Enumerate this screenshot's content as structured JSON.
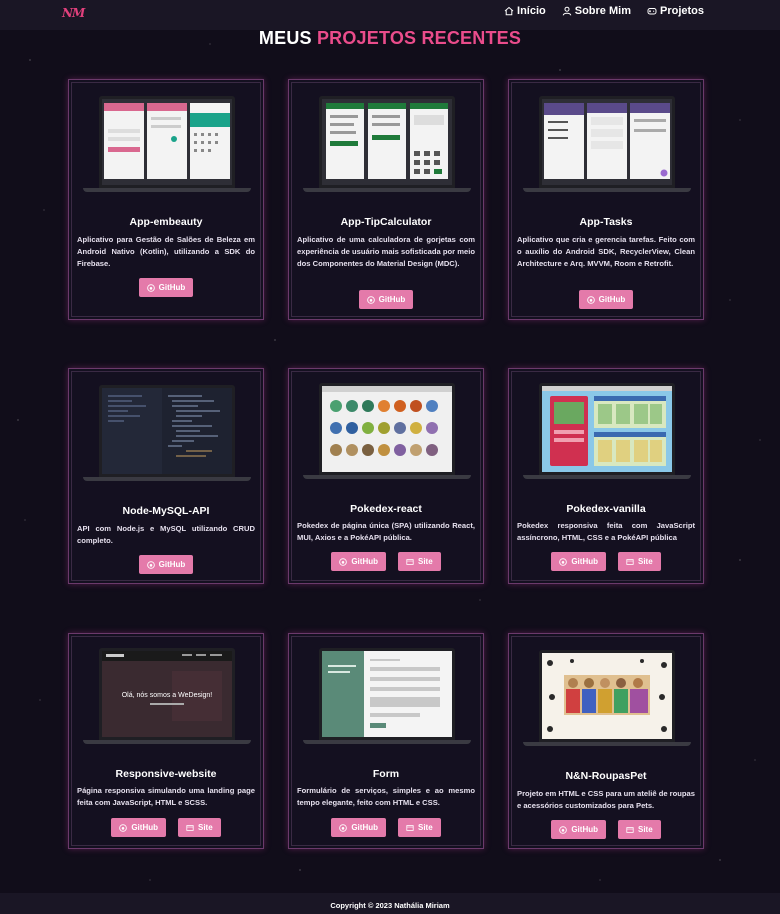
{
  "nav": {
    "logo": "NM",
    "links": [
      {
        "label": "Início",
        "icon": "home-icon"
      },
      {
        "label": "Sobre Mim",
        "icon": "user-icon"
      },
      {
        "label": "Projetos",
        "icon": "gamepad-icon"
      }
    ]
  },
  "section": {
    "title_part1": "MEUS ",
    "title_part2": "PROJETOS RECENTES"
  },
  "colors": {
    "accent": "#ea4c8b",
    "button": "#e47aaa",
    "background": "#110d1a",
    "navbar": "#1a1625"
  },
  "projects": [
    {
      "title": "App-embeauty",
      "description": "Aplicativo para Gestão de Salões de Beleza em Android Nativo (Kotlin), utilizando a SDK do Firebase.",
      "buttons": [
        "GitHub"
      ]
    },
    {
      "title": "App-TipCalculator",
      "description": "Aplicativo de uma calculadora de gorjetas com experiência de usuário mais sofisticada por meio dos Componentes do Material Design (MDC).",
      "buttons": [
        "GitHub"
      ]
    },
    {
      "title": "App-Tasks",
      "description": "Aplicativo que cria e gerencia tarefas. Feito com o auxílio do Android SDK, RecyclerView, Clean Architecture e Arq. MVVM, Room e Retrofit.",
      "buttons": [
        "GitHub"
      ]
    },
    {
      "title": "Node-MySQL-API",
      "description": "API com Node.js e MySQL utilizando CRUD completo.",
      "buttons": [
        "GitHub"
      ]
    },
    {
      "title": "Pokedex-react",
      "description": "Pokedex de página única (SPA) utilizando React, MUI, Axios e a PokéAPI pública.",
      "buttons": [
        "GitHub",
        "Site"
      ]
    },
    {
      "title": "Pokedex-vanilla",
      "description": "Pokedex responsiva feita com JavaScript assíncrono, HTML, CSS e a PokéAPI pública",
      "buttons": [
        "GitHub",
        "Site"
      ]
    },
    {
      "title": "Responsive-website",
      "description": "Página responsiva simulando uma landing page feita com JavaScript, HTML e SCSS.",
      "buttons": [
        "GitHub",
        "Site"
      ]
    },
    {
      "title": "Form",
      "description": "Formulário de serviços, simples e ao mesmo tempo elegante, feito com HTML e CSS.",
      "buttons": [
        "GitHub",
        "Site"
      ]
    },
    {
      "title": "N&N-RoupasPet",
      "description": "Projeto em HTML e CSS para um ateliê de roupas e acessórios customizados para Pets.",
      "buttons": [
        "GitHub",
        "Site"
      ]
    }
  ],
  "screens": {
    "webdesign_caption": "Olá, nós somos a WeDesign!"
  },
  "footer": {
    "copyright": "Copyright © 2023 Nathália Miriam"
  }
}
